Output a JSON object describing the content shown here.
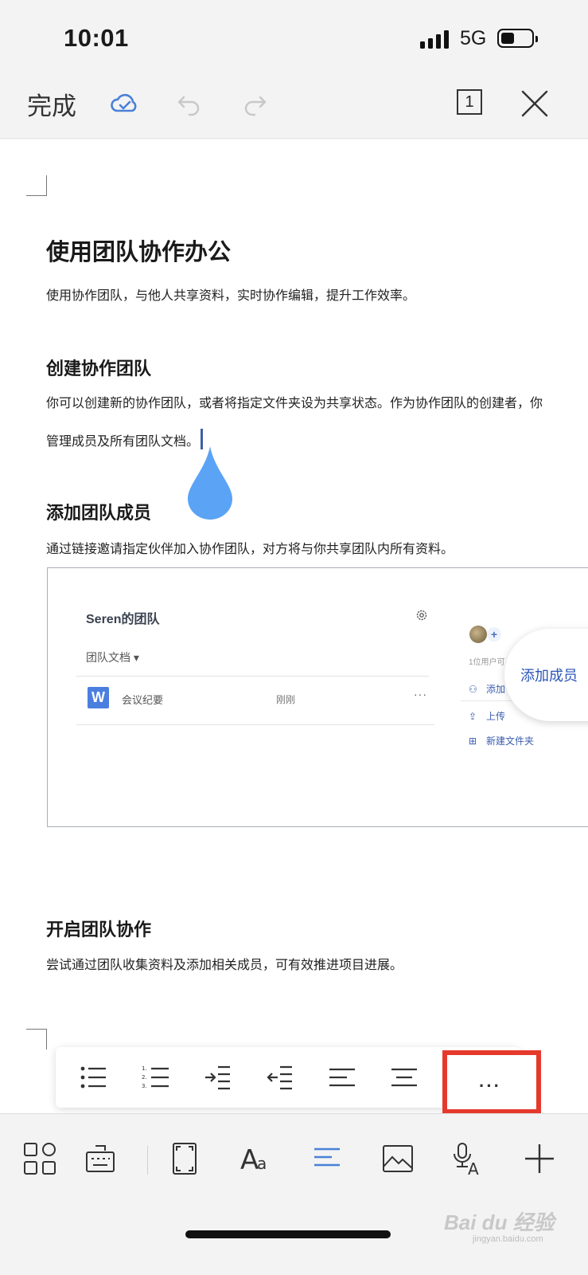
{
  "status_bar": {
    "time": "10:01",
    "network": "5G"
  },
  "top_toolbar": {
    "done_label": "完成",
    "page_count": "1"
  },
  "document": {
    "title": "使用团队协作办公",
    "intro": "使用协作团队，与他人共享资料，实时协作编辑，提升工作效率。",
    "sections": [
      {
        "heading": "创建协作团队",
        "lines": [
          "你可以创建新的协作团队，或者将指定文件夹设为共享状态。作为协作团队的创建者，你",
          "管理成员及所有团队文档。"
        ]
      },
      {
        "heading": "添加团队成员",
        "lines": [
          "通过链接邀请指定伙伴加入协作团队，对方将与你共享团队内所有资料。"
        ]
      },
      {
        "heading": "开启团队协作",
        "lines": [
          "尝试通过团队收集资料及添加相关成员，可有效推进项目进展。"
        ]
      }
    ],
    "embedded_screenshot": {
      "team_name": "Seren的团队",
      "docs_menu": "团队文档 ▾",
      "file": {
        "icon_letter": "W",
        "name": "会议纪要",
        "time": "刚刚",
        "more": "···"
      },
      "user_count": "1位用户可",
      "actions": [
        "添加",
        "上传",
        "新建文件夹"
      ],
      "callout": "添加成员"
    }
  },
  "format_toolbar": {
    "buttons": [
      "bulleted-list",
      "numbered-list",
      "indent-increase",
      "indent-decrease",
      "align-left",
      "align-center"
    ],
    "more_label": "···"
  },
  "bottom_toolbar": {
    "buttons": [
      "apps-grid",
      "keyboard",
      "full-screen",
      "font-style",
      "paragraph-format",
      "insert-image",
      "voice-input",
      "insert"
    ]
  },
  "watermark": {
    "brand": "Bai du 经验",
    "url": "jingyan.baidu.com"
  },
  "colors": {
    "accent_blue": "#4a80d8",
    "highlight_red": "#e5392d",
    "drop_blue": "#5aa3f5"
  }
}
